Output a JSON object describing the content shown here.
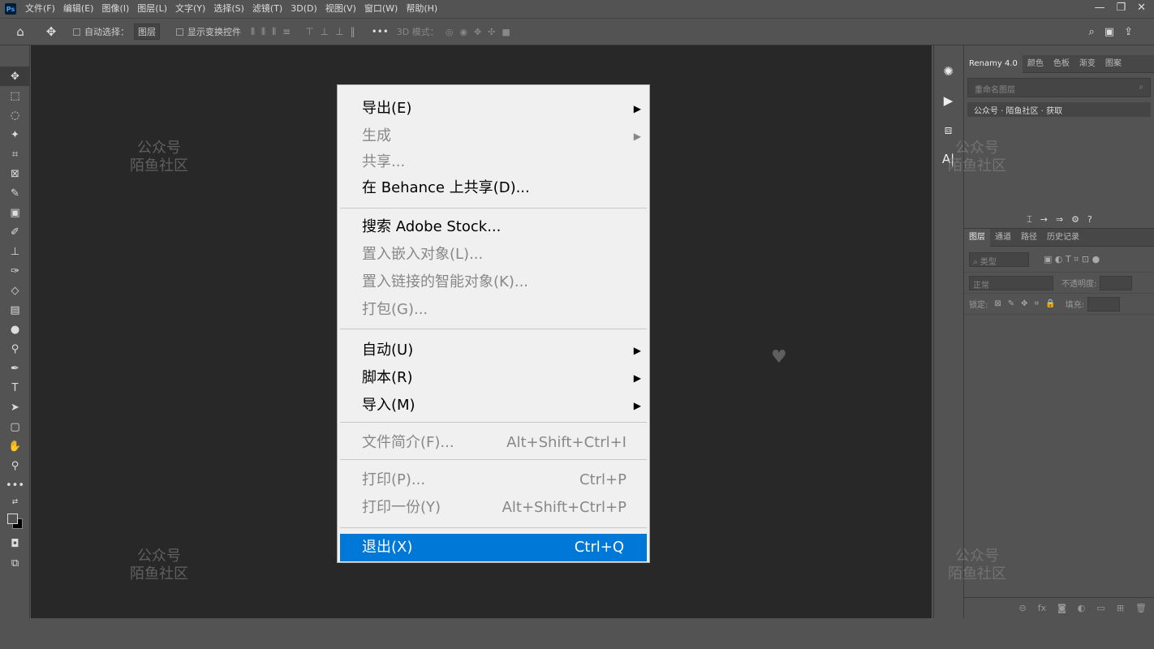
{
  "app": {
    "logo": "Ps"
  },
  "menubar": {
    "items": [
      "文件(F)",
      "编辑(E)",
      "图像(I)",
      "图层(L)",
      "文字(Y)",
      "选择(S)",
      "滤镜(T)",
      "3D(D)",
      "视图(V)",
      "窗口(W)",
      "帮助(H)"
    ]
  },
  "window": {
    "minimize": "—",
    "restore": "❐",
    "close": "✕"
  },
  "options": {
    "auto_select_label": "自动选择：",
    "auto_select_value": "图层",
    "show_transform_label": "显示变换控件",
    "mode3d_label": "3D 模式："
  },
  "panel": {
    "tabs": [
      "Renamy 4.0",
      "颜色",
      "色板",
      "渐变",
      "图案"
    ],
    "search_placeholder": "重命名图层",
    "link_text": "公众号 · 陌鱼社区 · 获取",
    "layers_tabs": [
      "图层",
      "通道",
      "路径",
      "历史记录"
    ],
    "filter_label": "类型",
    "blend_mode": "正常",
    "opacity_label": "不透明度:",
    "lock_label": "锁定:",
    "fill_label": "填充:"
  },
  "menu": {
    "items": [
      {
        "label": "导出(E)",
        "shortcut": "",
        "submenu": true,
        "disabled": false
      },
      {
        "label": "生成",
        "shortcut": "",
        "submenu": true,
        "disabled": true
      },
      {
        "label": "共享...",
        "shortcut": "",
        "submenu": false,
        "disabled": true
      },
      {
        "label": "在 Behance 上共享(D)...",
        "shortcut": "",
        "submenu": false,
        "disabled": false
      },
      {
        "label": "搜索 Adobe Stock...",
        "shortcut": "",
        "submenu": false,
        "disabled": false
      },
      {
        "label": "置入嵌入对象(L)...",
        "shortcut": "",
        "submenu": false,
        "disabled": true
      },
      {
        "label": "置入链接的智能对象(K)...",
        "shortcut": "",
        "submenu": false,
        "disabled": true
      },
      {
        "label": "打包(G)...",
        "shortcut": "",
        "submenu": false,
        "disabled": true
      },
      {
        "label": "自动(U)",
        "shortcut": "",
        "submenu": true,
        "disabled": false
      },
      {
        "label": "脚本(R)",
        "shortcut": "",
        "submenu": true,
        "disabled": false
      },
      {
        "label": "导入(M)",
        "shortcut": "",
        "submenu": true,
        "disabled": false
      },
      {
        "label": "文件简介(F)...",
        "shortcut": "Alt+Shift+Ctrl+I",
        "submenu": false,
        "disabled": true
      },
      {
        "label": "打印(P)...",
        "shortcut": "Ctrl+P",
        "submenu": false,
        "disabled": true
      },
      {
        "label": "打印一份(Y)",
        "shortcut": "Alt+Shift+Ctrl+P",
        "submenu": false,
        "disabled": true
      },
      {
        "label": "退出(X)",
        "shortcut": "Ctrl+Q",
        "submenu": false,
        "disabled": false,
        "highlighted": true
      }
    ]
  },
  "watermark": {
    "line1": "公众号",
    "line2": "陌鱼社区"
  }
}
